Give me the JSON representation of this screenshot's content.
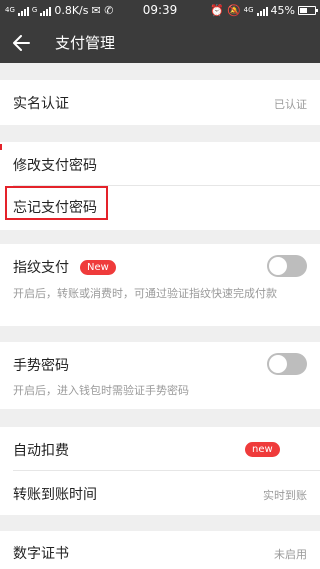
{
  "status_bar": {
    "left_text": "0.8K/s",
    "network_tag": "4G",
    "carrier_tag": "G",
    "time": "09:39",
    "right_network": "4G",
    "battery": "45%"
  },
  "header": {
    "title": "支付管理",
    "back_icon": "arrow-left-icon"
  },
  "items": {
    "real_name": {
      "label": "实名认证",
      "value": "已认证"
    },
    "change_password": {
      "label": "修改支付密码"
    },
    "forgot_password": {
      "label": "忘记支付密码"
    },
    "fingerprint": {
      "label": "指纹支付",
      "badge": "New",
      "description": "开启后，转账或消费时，可通过验证指纹快速完成付款",
      "enabled": false
    },
    "gesture": {
      "label": "手势密码",
      "description": "开启后，进入钱包时需验证手势密码",
      "enabled": false
    },
    "auto_debit": {
      "label": "自动扣费",
      "badge": "new"
    },
    "transfer_time": {
      "label": "转账到账时间",
      "value": "实时到账"
    },
    "certificate": {
      "label": "数字证书",
      "value": "未启用"
    }
  },
  "colors": {
    "header_bg": "#3b3b3b",
    "page_bg": "#efefef",
    "badge": "#ef3b3b",
    "highlight": "#e4222a"
  }
}
